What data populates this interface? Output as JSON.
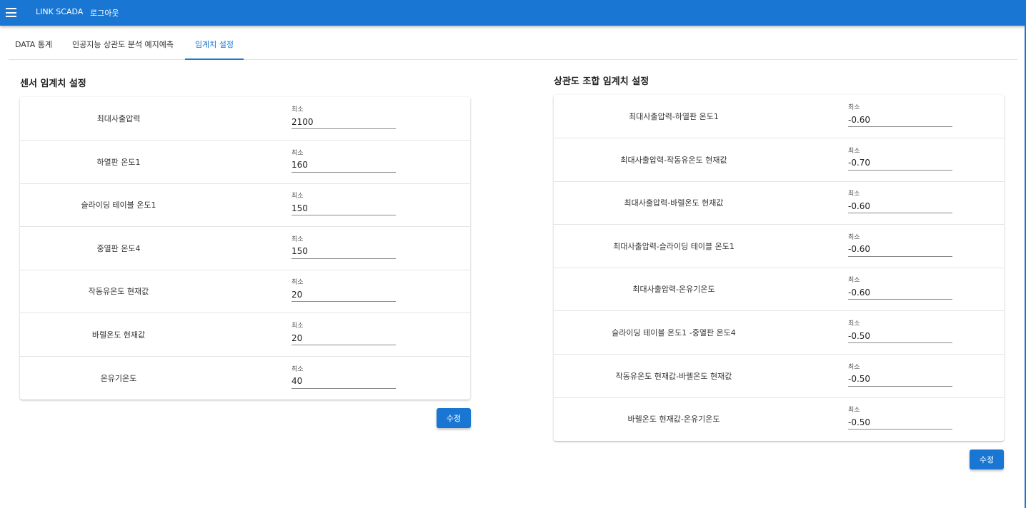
{
  "appbar": {
    "brand": "LINK SCADA",
    "logout": "로그아웃"
  },
  "tabs": [
    {
      "label": "DATA 통계"
    },
    {
      "label": "인공지능 상관도 분석 예지예측"
    },
    {
      "label": "임계치 설정"
    }
  ],
  "active_tab": 2,
  "sensor": {
    "title": "센서 임계치 설정",
    "field_label": "최소",
    "rows": [
      {
        "name": "최대사출압력",
        "value": "2100"
      },
      {
        "name": "하열판 온도1",
        "value": "160"
      },
      {
        "name": "슬라이딩 테이블 온도1",
        "value": "150"
      },
      {
        "name": "중열판 온도4",
        "value": "150"
      },
      {
        "name": "작동유온도 현재값",
        "value": "20"
      },
      {
        "name": "바렐온도 현재값",
        "value": "20"
      },
      {
        "name": "온유기온도",
        "value": "40"
      }
    ],
    "submit_label": "수정"
  },
  "correlation": {
    "title": "상관도 조합 임계치 설정",
    "field_label": "최소",
    "rows": [
      {
        "name": "최대사출압력-하열판 온도1",
        "value": "-0.60"
      },
      {
        "name": "최대사출압력-작동유온도 현재값",
        "value": "-0.70"
      },
      {
        "name": "최대사출압력-바렐온도 현재값",
        "value": "-0.60"
      },
      {
        "name": "최대사출압력-슬라이딩 테이블 온도1",
        "value": "-0.60"
      },
      {
        "name": "최대사출압력-온유기온도",
        "value": "-0.60"
      },
      {
        "name": "슬라이딩 테이블 온도1 -중열판 온도4",
        "value": "-0.50"
      },
      {
        "name": "작동유온도 현재값-바렐온도 현재값",
        "value": "-0.50"
      },
      {
        "name": "바렐온도 현재값-온유기온도",
        "value": "-0.50"
      }
    ],
    "submit_label": "수정"
  },
  "colors": {
    "primary": "#1976d2",
    "divider": "#e0e0e0"
  },
  "icons": {
    "menu": "hamburger-menu-icon"
  }
}
